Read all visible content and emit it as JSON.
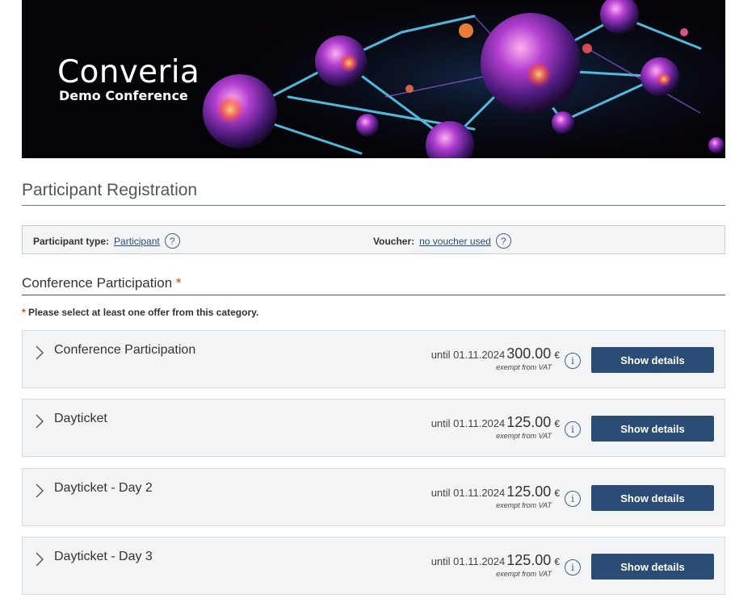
{
  "banner": {
    "brand_name": "Converia",
    "brand_sub": "Demo Conference"
  },
  "page_title": "Participant Registration",
  "info_bar": {
    "participant_type_label": "Participant type:",
    "participant_type_value": "Participant",
    "voucher_label": "Voucher:",
    "voucher_value": "no voucher used",
    "help_glyph": "?"
  },
  "section": {
    "title": "Conference Participation",
    "required_marker": "*",
    "note_marker": "*",
    "note": "Please select at least one offer from this category."
  },
  "offers": [
    {
      "name": "Conference Participation",
      "until": "until 01.11.2024",
      "price": "300.00",
      "currency": "€",
      "vat": "exempt from VAT",
      "button": "Show details",
      "info_glyph": "i"
    },
    {
      "name": "Dayticket",
      "until": "until 01.11.2024",
      "price": "125.00",
      "currency": "€",
      "vat": "exempt from VAT",
      "button": "Show details",
      "info_glyph": "i"
    },
    {
      "name": "Dayticket - Day 2",
      "until": "until 01.11.2024",
      "price": "125.00",
      "currency": "€",
      "vat": "exempt from VAT",
      "button": "Show details",
      "info_glyph": "i"
    },
    {
      "name": "Dayticket - Day 3",
      "until": "until 01.11.2024",
      "price": "125.00",
      "currency": "€",
      "vat": "exempt from VAT",
      "button": "Show details",
      "info_glyph": "i"
    }
  ],
  "colors": {
    "button": "#2b4c74",
    "link": "#2b4f7a",
    "required": "#d9401e",
    "row_bg": "#f3f4f6"
  }
}
